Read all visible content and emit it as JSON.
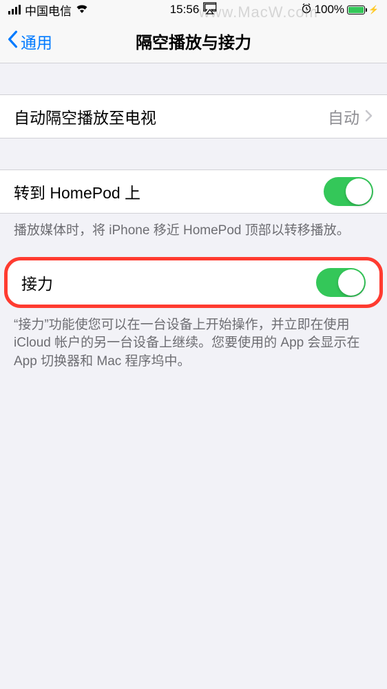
{
  "status_bar": {
    "carrier": "中国电信",
    "time": "15:56",
    "battery_percent": "100%"
  },
  "nav": {
    "back_label": "通用",
    "title": "隔空播放与接力"
  },
  "cells": {
    "airplay_tv": {
      "label": "自动隔空播放至电视",
      "value": "自动"
    },
    "homepod": {
      "label": "转到 HomePod 上",
      "footer": "播放媒体时，将 iPhone 移近 HomePod 顶部以转移播放。"
    },
    "handoff": {
      "label": "接力",
      "footer": "“接力”功能使您可以在一台设备上开始操作，并立即在使用 iCloud 帐户的另一台设备上继续。您要使用的 App 会显示在 App 切换器和 Mac 程序坞中。"
    }
  },
  "watermark": "www.MacW.com"
}
